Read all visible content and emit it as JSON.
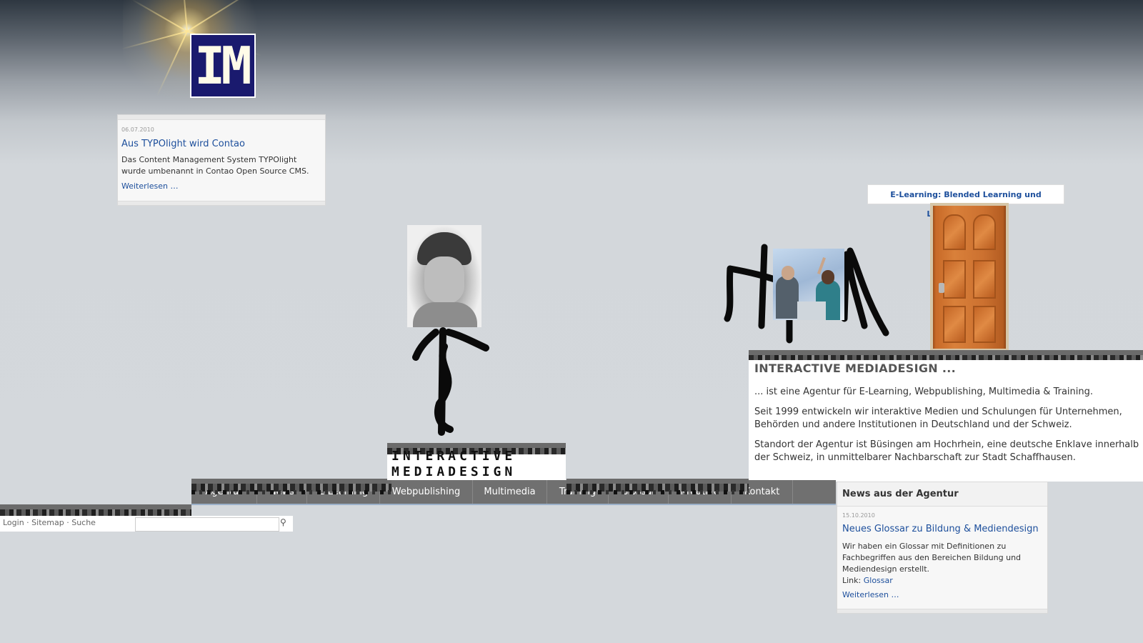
{
  "logo": {
    "text": "IM"
  },
  "teaser_top": {
    "date": "06.07.2010",
    "title": "Aus TYPOlight wird Contao",
    "body": "Das Content Management System TYPOlight wurde umbenannt in Contao Open Source CMS.",
    "more": "Weiterlesen …"
  },
  "nav": {
    "items": [
      {
        "label": "Agentur"
      },
      {
        "label": "News"
      },
      {
        "label": "E-Learning"
      },
      {
        "label": "Webpublishing"
      },
      {
        "label": "Multimedia"
      },
      {
        "label": "Training"
      },
      {
        "label": "Glossar"
      },
      {
        "label": "Kreative"
      },
      {
        "label": "Kontakt"
      }
    ]
  },
  "sign": {
    "line1": "INTERACTIVE",
    "line2": "MEDIADESIGN"
  },
  "search": {
    "links": "Login · Sitemap · Suche",
    "placeholder": ""
  },
  "article": {
    "heading": "INTERACTIVE MEDIADESIGN ...",
    "p1": "... ist eine Agentur für E-Learning, Webpublishing, Multimedia & Training.",
    "p2": "Seit 1999 entwickeln wir interaktive Medien und Schulungen für Unternehmen, Behörden und andere Institutionen in Deutschland und der Schweiz.",
    "p3": "Standort der Agentur ist Büsingen am Hochrhein, eine deutsche Enklave innerhalb der Schweiz, in unmittelbarer Nachbarschaft zur Stadt Schaffhausen."
  },
  "elearning_link": "E-Learning: Blended Learning und Lernmanagement",
  "news_right": {
    "heading": "News aus der Agentur",
    "date": "15.10.2010",
    "title": "Neues Glossar zu Bildung & Mediendesign",
    "body": "Wir haben ein Glossar mit Definitionen zu Fachbegriffen aus den Bereichen Bildung und Mediendesign erstellt.",
    "link_prefix": "Link:",
    "link": "Glossar",
    "more": "Weiterlesen …"
  },
  "colors": {
    "link": "#1d4f9c",
    "nav_bg": "#707070",
    "logo_bg": "#1a1a6e"
  },
  "icons": {
    "search": "magnifier-icon"
  }
}
